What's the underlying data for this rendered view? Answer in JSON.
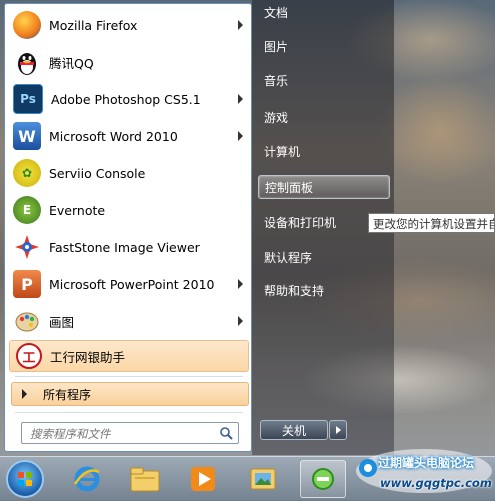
{
  "start_menu": {
    "programs": [
      {
        "label": "Mozilla Firefox",
        "icon": "firefox-icon",
        "has_submenu": true
      },
      {
        "label": "腾讯QQ",
        "icon": "qq-icon",
        "has_submenu": false
      },
      {
        "label": "Adobe Photoshop CS5.1",
        "icon": "photoshop-icon",
        "has_submenu": true
      },
      {
        "label": "Microsoft Word 2010",
        "icon": "word-icon",
        "has_submenu": true
      },
      {
        "label": "Serviio Console",
        "icon": "serviio-icon",
        "has_submenu": false
      },
      {
        "label": "Evernote",
        "icon": "evernote-icon",
        "has_submenu": false
      },
      {
        "label": "FastStone Image Viewer",
        "icon": "faststone-icon",
        "has_submenu": false
      },
      {
        "label": "Microsoft PowerPoint 2010",
        "icon": "powerpoint-icon",
        "has_submenu": true
      },
      {
        "label": "画图",
        "icon": "paint-icon",
        "has_submenu": true
      },
      {
        "label": "工行网银助手",
        "icon": "icbc-icon",
        "has_submenu": false
      }
    ],
    "all_programs": "所有程序",
    "search": {
      "placeholder": "搜索程序和文件"
    },
    "right_items": [
      {
        "label": "文档"
      },
      {
        "label": "图片"
      },
      {
        "label": "音乐"
      },
      {
        "label": "游戏"
      },
      {
        "label": "计算机"
      },
      {
        "label": "控制面板"
      },
      {
        "label": "设备和打印机"
      },
      {
        "label": "默认程序"
      },
      {
        "label": "帮助和支持"
      }
    ],
    "shutdown_label": "关机",
    "tooltip": "更改您的计算机设置并自"
  },
  "taskbar": {
    "items": [
      {
        "icon": "internet-explorer-icon"
      },
      {
        "icon": "folder-icon"
      },
      {
        "icon": "media-player-icon"
      },
      {
        "icon": "image-folder-icon"
      },
      {
        "icon": "ie-active-icon",
        "active": true
      }
    ]
  },
  "watermark": {
    "title": "过期罐头电脑论坛",
    "url": "www.gqgtpc.com"
  },
  "colors": {
    "highlight": "#fbd7a7",
    "menu_border": "#6d8fb5",
    "start_orb": "#1a5fa8"
  }
}
